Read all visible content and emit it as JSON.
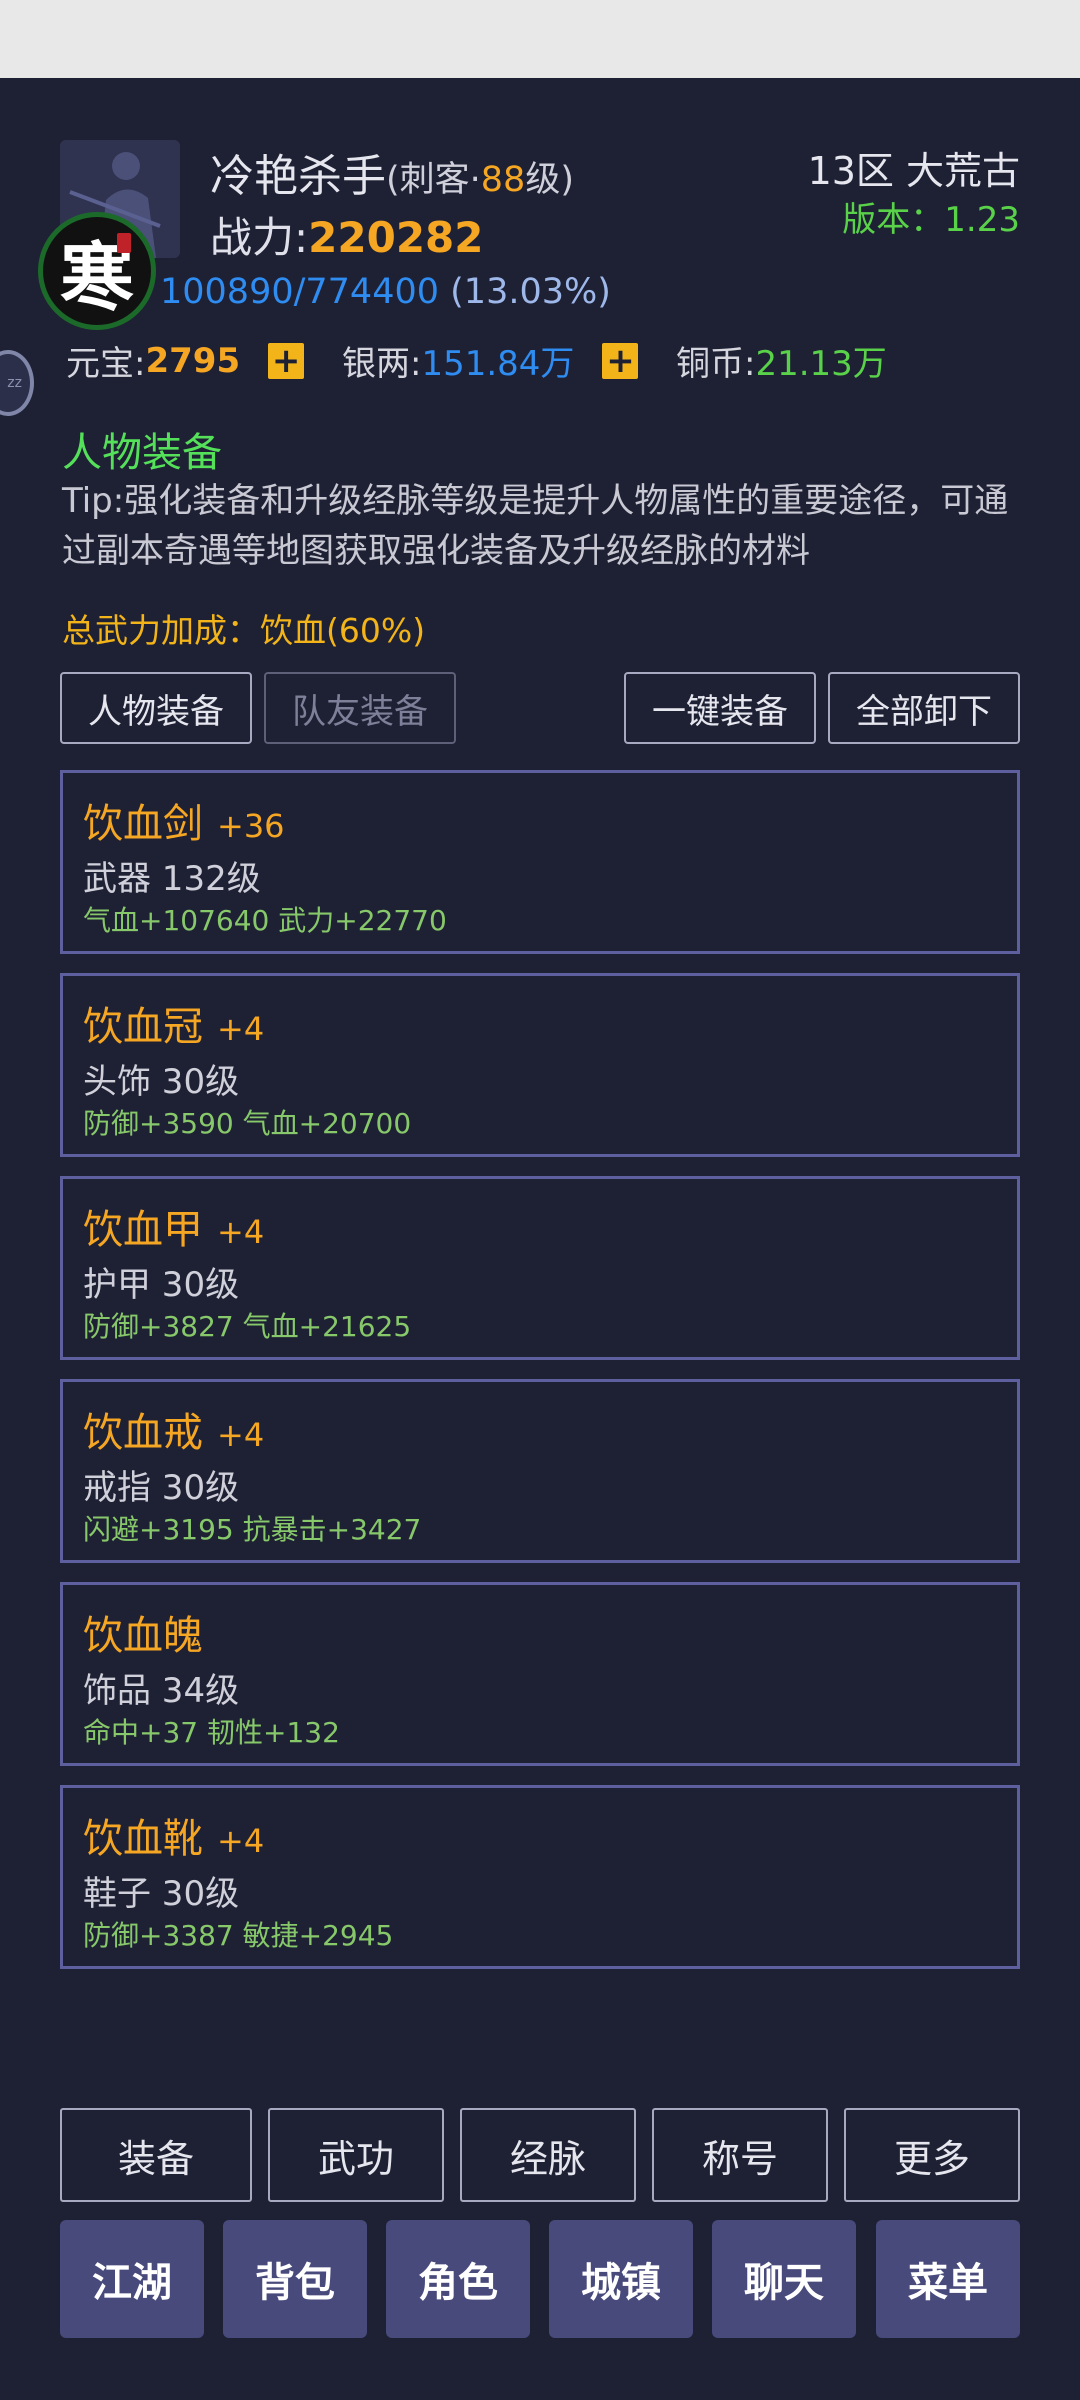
{
  "header": {
    "name": "冷艳杀手",
    "meta_prefix": "(刺客·",
    "level": "88",
    "meta_suffix": "级)",
    "power_label": "战力:",
    "power_value": "220282",
    "exp_value": "100890/774400",
    "exp_percent": "(13.03%)",
    "server": "13区 大荒古",
    "version": "版本：1.23",
    "seal_text": "寒",
    "side_handle_text": "zz"
  },
  "currency": {
    "yuanbao_label": "元宝:",
    "yuanbao_value": "2795",
    "silver_label": "银两:",
    "silver_value": "151.84万",
    "copper_label": "铜币:",
    "copper_value": "21.13万",
    "plus_glyph": "+"
  },
  "section": {
    "title": "人物装备",
    "tip": "Tip:强化装备和升级经脉等级是提升人物属性的重要途径，可通过副本奇遇等地图获取强化装备及升级经脉的材料",
    "total_bonus": "总武力加成：饮血(60%)"
  },
  "buttons": {
    "char_equip": "人物装备",
    "team_equip": "队友装备",
    "one_key_equip": "一键装备",
    "unequip_all": "全部卸下"
  },
  "equipment": [
    {
      "name": "饮血剑",
      "plus": "+36",
      "type": "武器 132级",
      "attrs": "气血+107640 武力+22770"
    },
    {
      "name": "饮血冠",
      "plus": "+4",
      "type": "头饰 30级",
      "attrs": "防御+3590 气血+20700"
    },
    {
      "name": "饮血甲",
      "plus": "+4",
      "type": "护甲 30级",
      "attrs": "防御+3827 气血+21625"
    },
    {
      "name": "饮血戒",
      "plus": "+4",
      "type": "戒指 30级",
      "attrs": "闪避+3195 抗暴击+3427"
    },
    {
      "name": "饮血魄",
      "plus": "",
      "type": "饰品 34级",
      "attrs": "命中+37 韧性+132"
    },
    {
      "name": "饮血靴",
      "plus": "+4",
      "type": "鞋子 30级",
      "attrs": "防御+3387 敏捷+2945"
    }
  ],
  "subtabs": [
    "装备",
    "武功",
    "经脉",
    "称号",
    "更多"
  ],
  "nav": [
    "江湖",
    "背包",
    "角色",
    "城镇",
    "聊天",
    "菜单"
  ],
  "colors": {
    "background": "#1e2034",
    "gold": "#f5a623",
    "blue": "#2f8cf0",
    "green": "#59d24a",
    "card_border": "#5d5f9e",
    "nav_button": "#484a7c"
  }
}
